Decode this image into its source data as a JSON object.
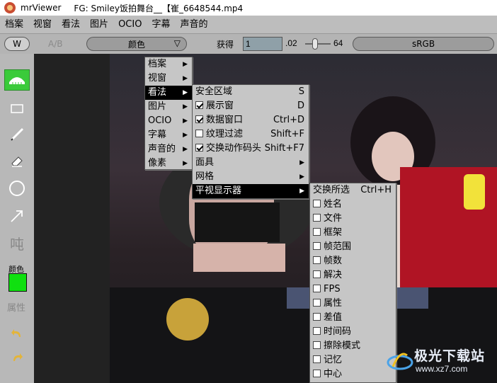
{
  "window": {
    "app": "mrViewer",
    "title": "FG: Smiley饭拍舞台__【崔_6648544.mp4"
  },
  "menubar": [
    "档案",
    "视窗",
    "看法",
    "图片",
    "OCIO",
    "字幕",
    "声音的"
  ],
  "toolbar": {
    "w_label": "W",
    "ab_label": "A/B",
    "channel_value": "颜色",
    "gain_label": "获得",
    "gain_value": "1",
    "gamma_value": ".02",
    "max_value": "64",
    "colorspace": "sRGB"
  },
  "sidepanel": {
    "text_tool": "吨",
    "color_label": "颜色",
    "color_value": "#10e010",
    "props_label": "属性"
  },
  "menu_main": [
    "档案",
    "视窗",
    "看法",
    "图片",
    "OCIO",
    "字幕",
    "声音的",
    "像素"
  ],
  "menu_view": [
    {
      "label": "安全区域",
      "shortcut": "S",
      "check": null
    },
    {
      "label": "展示窗",
      "shortcut": "D",
      "check": true
    },
    {
      "label": "数据窗口",
      "shortcut": "Ctrl+D",
      "check": true
    },
    {
      "label": "纹理过滤",
      "shortcut": "Shift+F",
      "check": false
    },
    {
      "label": "交换动作码头",
      "shortcut": "Shift+F7",
      "check": true
    },
    {
      "label": "面具",
      "shortcut": "",
      "check": null,
      "submenu": true
    },
    {
      "label": "网格",
      "shortcut": "",
      "check": null,
      "submenu": true
    },
    {
      "label": "平视显示器",
      "shortcut": "",
      "check": null,
      "submenu": true
    }
  ],
  "menu_hud": {
    "toggle": {
      "label": "交换所选",
      "shortcut": "Ctrl+H"
    },
    "items": [
      "姓名",
      "文件",
      "框架",
      "帧范围",
      "帧数",
      "解决",
      "FPS",
      "属性",
      "差值",
      "时间码",
      "擦除模式",
      "记忆",
      "中心"
    ]
  },
  "watermark": {
    "text": "极光下载站",
    "url": "www.xz7.com"
  }
}
